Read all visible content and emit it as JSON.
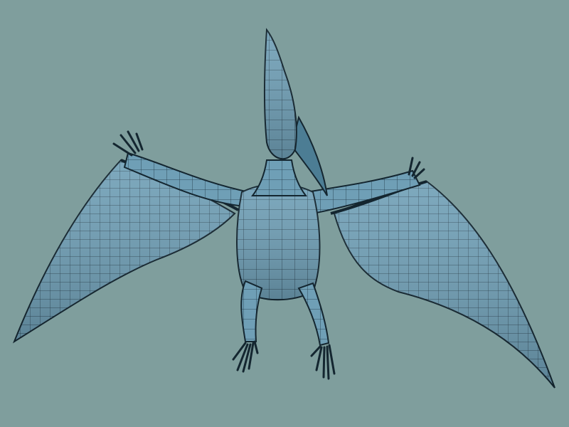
{
  "scene": {
    "subject": "pteranodon-wireframe-model",
    "background_color": "#7f9e9d",
    "mesh_fill_color": "#6f9fb6",
    "mesh_shadow_color": "#4c7d94",
    "wire_color": "#1d3340",
    "outline_color": "#142630"
  }
}
